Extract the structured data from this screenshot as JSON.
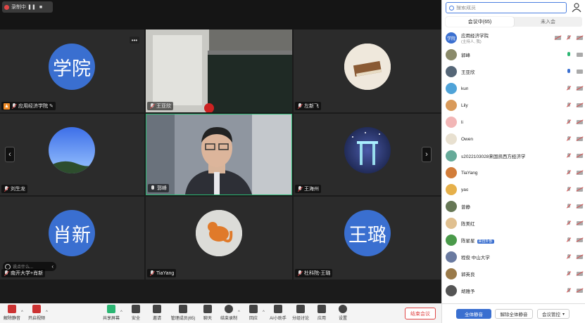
{
  "recording": {
    "label": "录制中"
  },
  "tiles": [
    {
      "name": "应用经济学院",
      "avatar_text": "学院",
      "host": true
    },
    {
      "name": "王亚欣",
      "kind": "video-blackboard"
    },
    {
      "name": "左新飞",
      "kind": "photo-book"
    },
    {
      "name": "刘生龙",
      "kind": "photo-sky"
    },
    {
      "name": "郭峰",
      "kind": "video-speaker"
    },
    {
      "name": "王海州",
      "kind": "photo-gate"
    },
    {
      "name": "南开大学+肖新",
      "avatar_text": "肖新",
      "chat_placeholder": "说点什么..."
    },
    {
      "name": "TiaYang",
      "kind": "photo-cat"
    },
    {
      "name": "杜科院-王璐",
      "avatar_text": "王璐"
    }
  ],
  "toolbar": {
    "items": [
      {
        "label": "解除静音"
      },
      {
        "label": "开启视频"
      },
      {
        "label": "共享屏幕"
      },
      {
        "label": "安全"
      },
      {
        "label": "邀请"
      },
      {
        "label": "管理成员(65)"
      },
      {
        "label": "聊天"
      },
      {
        "label": "结束录制"
      },
      {
        "label": "回应"
      },
      {
        "label": "AI小助手"
      },
      {
        "label": "分组讨论"
      },
      {
        "label": "应用"
      },
      {
        "label": "设置"
      }
    ],
    "end_meeting": "结束会议"
  },
  "panel": {
    "search_placeholder": "搜索成员",
    "tabs": {
      "in_meeting": "会议中(65)",
      "not_joined": "未入会"
    },
    "members": [
      {
        "name": "应用经济学院",
        "sub": "(主持人, 我)",
        "avatar_text": "学院",
        "color": "#3a6fd0",
        "mic": "off",
        "cam": "off"
      },
      {
        "name": "郭峰",
        "color": "#8a8a6a",
        "mic": "green",
        "cam": "on"
      },
      {
        "name": "王亚欣",
        "color": "#556677",
        "mic": "talk",
        "cam": "on"
      },
      {
        "name": "kun",
        "color": "#4fa3d8",
        "mic": "off",
        "cam": "off"
      },
      {
        "name": "Lily",
        "color": "#d99a5a",
        "mic": "off",
        "cam": "off"
      },
      {
        "name": "li",
        "color": "#f2b6b6",
        "mic": "off",
        "cam": "off"
      },
      {
        "name": "Owen",
        "color": "#e8e0d0",
        "mic": "off",
        "cam": "off"
      },
      {
        "name": "s2022103028来国凯西方经济学",
        "color": "#66aa99",
        "mic": "off",
        "cam": "off"
      },
      {
        "name": "TiaYang",
        "color": "#d27d3a",
        "mic": "off",
        "cam": "off"
      },
      {
        "name": "yao",
        "color": "#e6b04a",
        "mic": "off",
        "cam": "off"
      },
      {
        "name": "曾静",
        "color": "#667755",
        "mic": "off",
        "cam": "off"
      },
      {
        "name": "陈美红",
        "color": "#e0c090",
        "mic": "off",
        "cam": "off"
      },
      {
        "name": "陈星星",
        "tag": "来自外部",
        "color": "#4a9a4a",
        "mic": "off",
        "cam": "off"
      },
      {
        "name": "程俊 中山大学",
        "color": "#6a7aa0",
        "mic": "off",
        "cam": "off"
      },
      {
        "name": "郭英良",
        "color": "#9a7a4a",
        "mic": "off",
        "cam": "off"
      },
      {
        "name": "胡雅予",
        "color": "#555555",
        "mic": "off",
        "cam": "off"
      }
    ],
    "footer": {
      "mute_all": "全体静音",
      "unmute_all": "解除全体静音",
      "manage": "会议管控"
    }
  },
  "colors": {
    "accent": "#3a6fd0",
    "danger": "#e04747",
    "speaker_border": "#2bb673"
  }
}
